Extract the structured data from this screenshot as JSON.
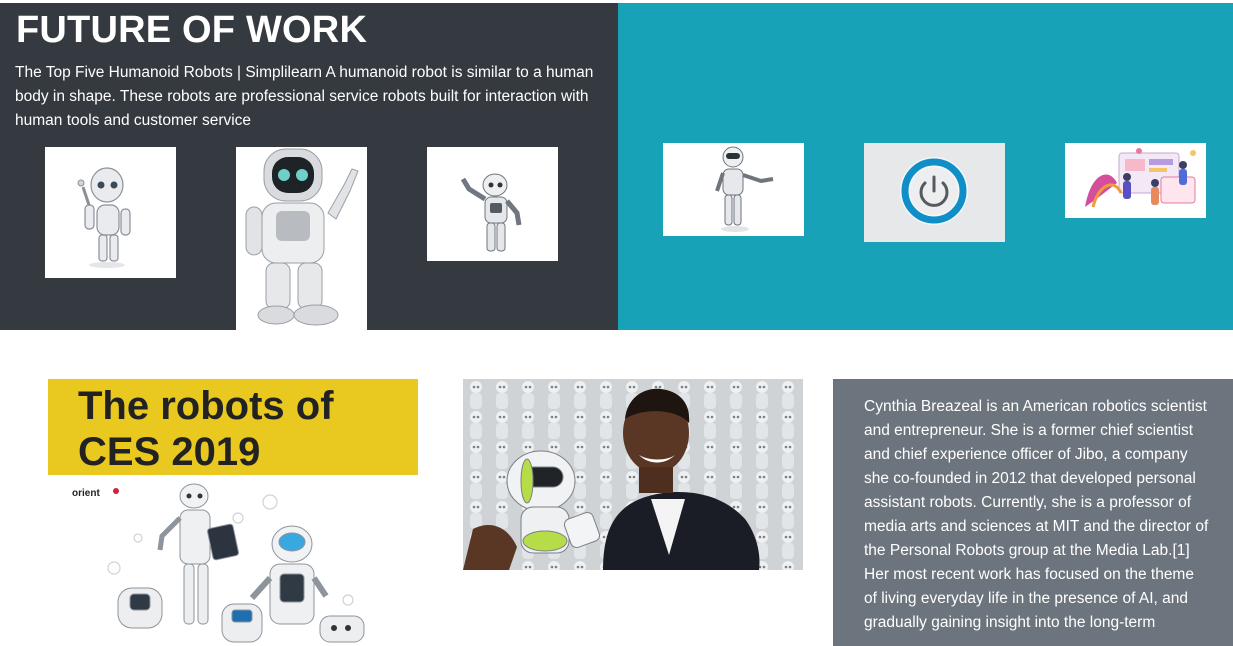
{
  "hero": {
    "title": "FUTURE OF WORK",
    "description": "The Top Five Humanoid Robots | Simplilearn A humanoid robot is similar to a human body in shape. These robots are professional service robots built for interaction with human tools and customer service"
  },
  "gallery_left": [
    {
      "name": "robot-thumbnail-1",
      "alt": "white humanoid robot"
    },
    {
      "name": "robot-thumbnail-2",
      "alt": "white service robot waving"
    },
    {
      "name": "robot-thumbnail-3",
      "alt": "small humanoid robot"
    }
  ],
  "gallery_right": [
    {
      "name": "robot-thumbnail-4",
      "alt": "robot presenting"
    },
    {
      "name": "power-button-thumbnail",
      "alt": "power button"
    },
    {
      "name": "team-illustration-thumbnail",
      "alt": "team illustration"
    }
  ],
  "feature": {
    "heading": "The robots of CES 2019",
    "logo_text": "orient"
  },
  "bio": {
    "text": "Cynthia Breazeal is an American robotics scientist and entrepreneur. She is a former chief scientist and chief experience officer of Jibo, a company she co-founded in 2012 that developed personal assistant robots. Currently, she is a professor of media arts and sciences at MIT and the director of the Personal Robots group at the Media Lab.[1] Her most recent work has focused on the theme of living everyday life in the presence of AI, and gradually gaining insight into the long-term"
  },
  "colors": {
    "dark_panel": "#343a40",
    "teal_panel": "#17a2b8",
    "yellow_banner": "#e9c920",
    "grey_panel": "#6c757d"
  }
}
